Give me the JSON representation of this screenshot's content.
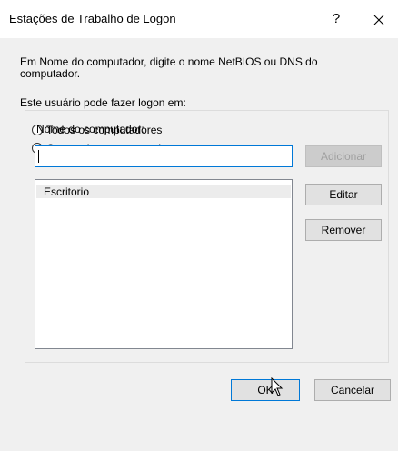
{
  "window": {
    "title": "Estações de Trabalho de Logon",
    "help_label": "?"
  },
  "form": {
    "description": "Em Nome do computador, digite o nome NetBIOS ou DNS do computador.",
    "logon_label": "Este usuário pode fazer logon em:",
    "radio_all": {
      "label": "Todos os computadores",
      "checked": false
    },
    "radio_following": {
      "label": "Os seguintes computadores",
      "checked": true
    },
    "computer_name_label": "Nome do computador:",
    "computer_name_value": "",
    "add_button": "Adicionar",
    "edit_button": "Editar",
    "remove_button": "Remover",
    "computers": [
      "Escritorio"
    ]
  },
  "footer": {
    "ok_button": "OK",
    "cancel_button": "Cancelar"
  },
  "colors": {
    "focus_blue": "#0078d7",
    "dialog_bg": "#f0f0f0"
  }
}
